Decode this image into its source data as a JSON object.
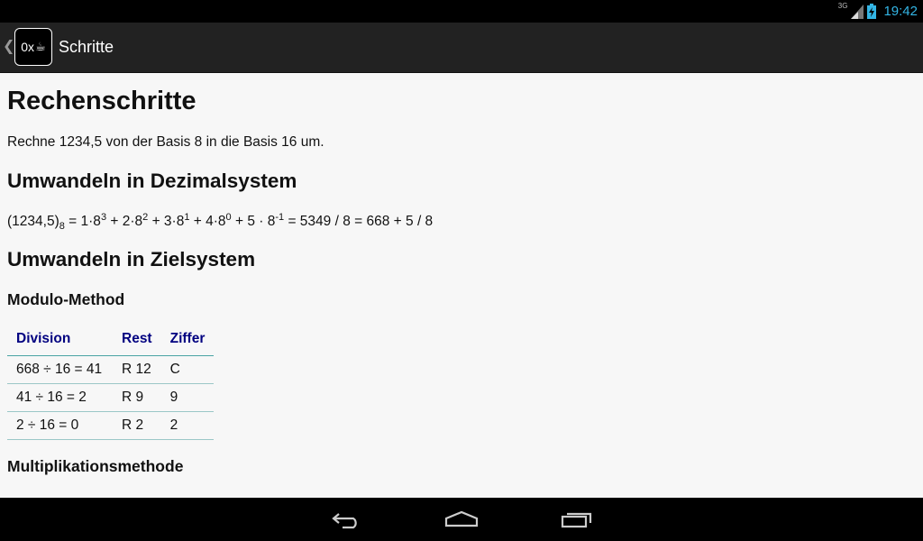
{
  "status_bar": {
    "network_label": "3G",
    "time": "19:42"
  },
  "action_bar": {
    "app_icon_text": "0x",
    "title": "Schritte"
  },
  "content": {
    "heading": "Rechenschritte",
    "intro": "Rechne 1234,5 von der Basis 8 in die Basis 16 um.",
    "section_decimal": "Umwandeln in Dezimalsystem",
    "formula": {
      "number": "(1234,5)",
      "base": "8",
      "eq": " = 1·8",
      "exp1": "3",
      "t2": " + 2·8",
      "exp2": "2",
      "t3": " + 3·8",
      "exp3": "1",
      "t4": " + 4·8",
      "exp4": "0",
      "t5": " + 5 · 8",
      "exp5": "-1",
      "result": " = 5349 / 8 = 668 + 5 / 8"
    },
    "section_target": "Umwandeln in Zielsystem",
    "modulo_heading": "Modulo-Method",
    "table": {
      "headers": [
        "Division",
        "Rest",
        "Ziffer"
      ],
      "rows": [
        [
          "668 ÷ 16 = 41",
          "R 12",
          "C"
        ],
        [
          "41 ÷ 16 = 2",
          "R 9",
          "9"
        ],
        [
          "2 ÷ 16 = 0",
          "R 2",
          "2"
        ]
      ]
    },
    "multiplication_heading": "Multiplikationsmethode"
  },
  "colors": {
    "action_bar": "#222222",
    "content_bg": "#f7f7f7",
    "table_header": "#000080",
    "clock": "#33b5e5"
  }
}
